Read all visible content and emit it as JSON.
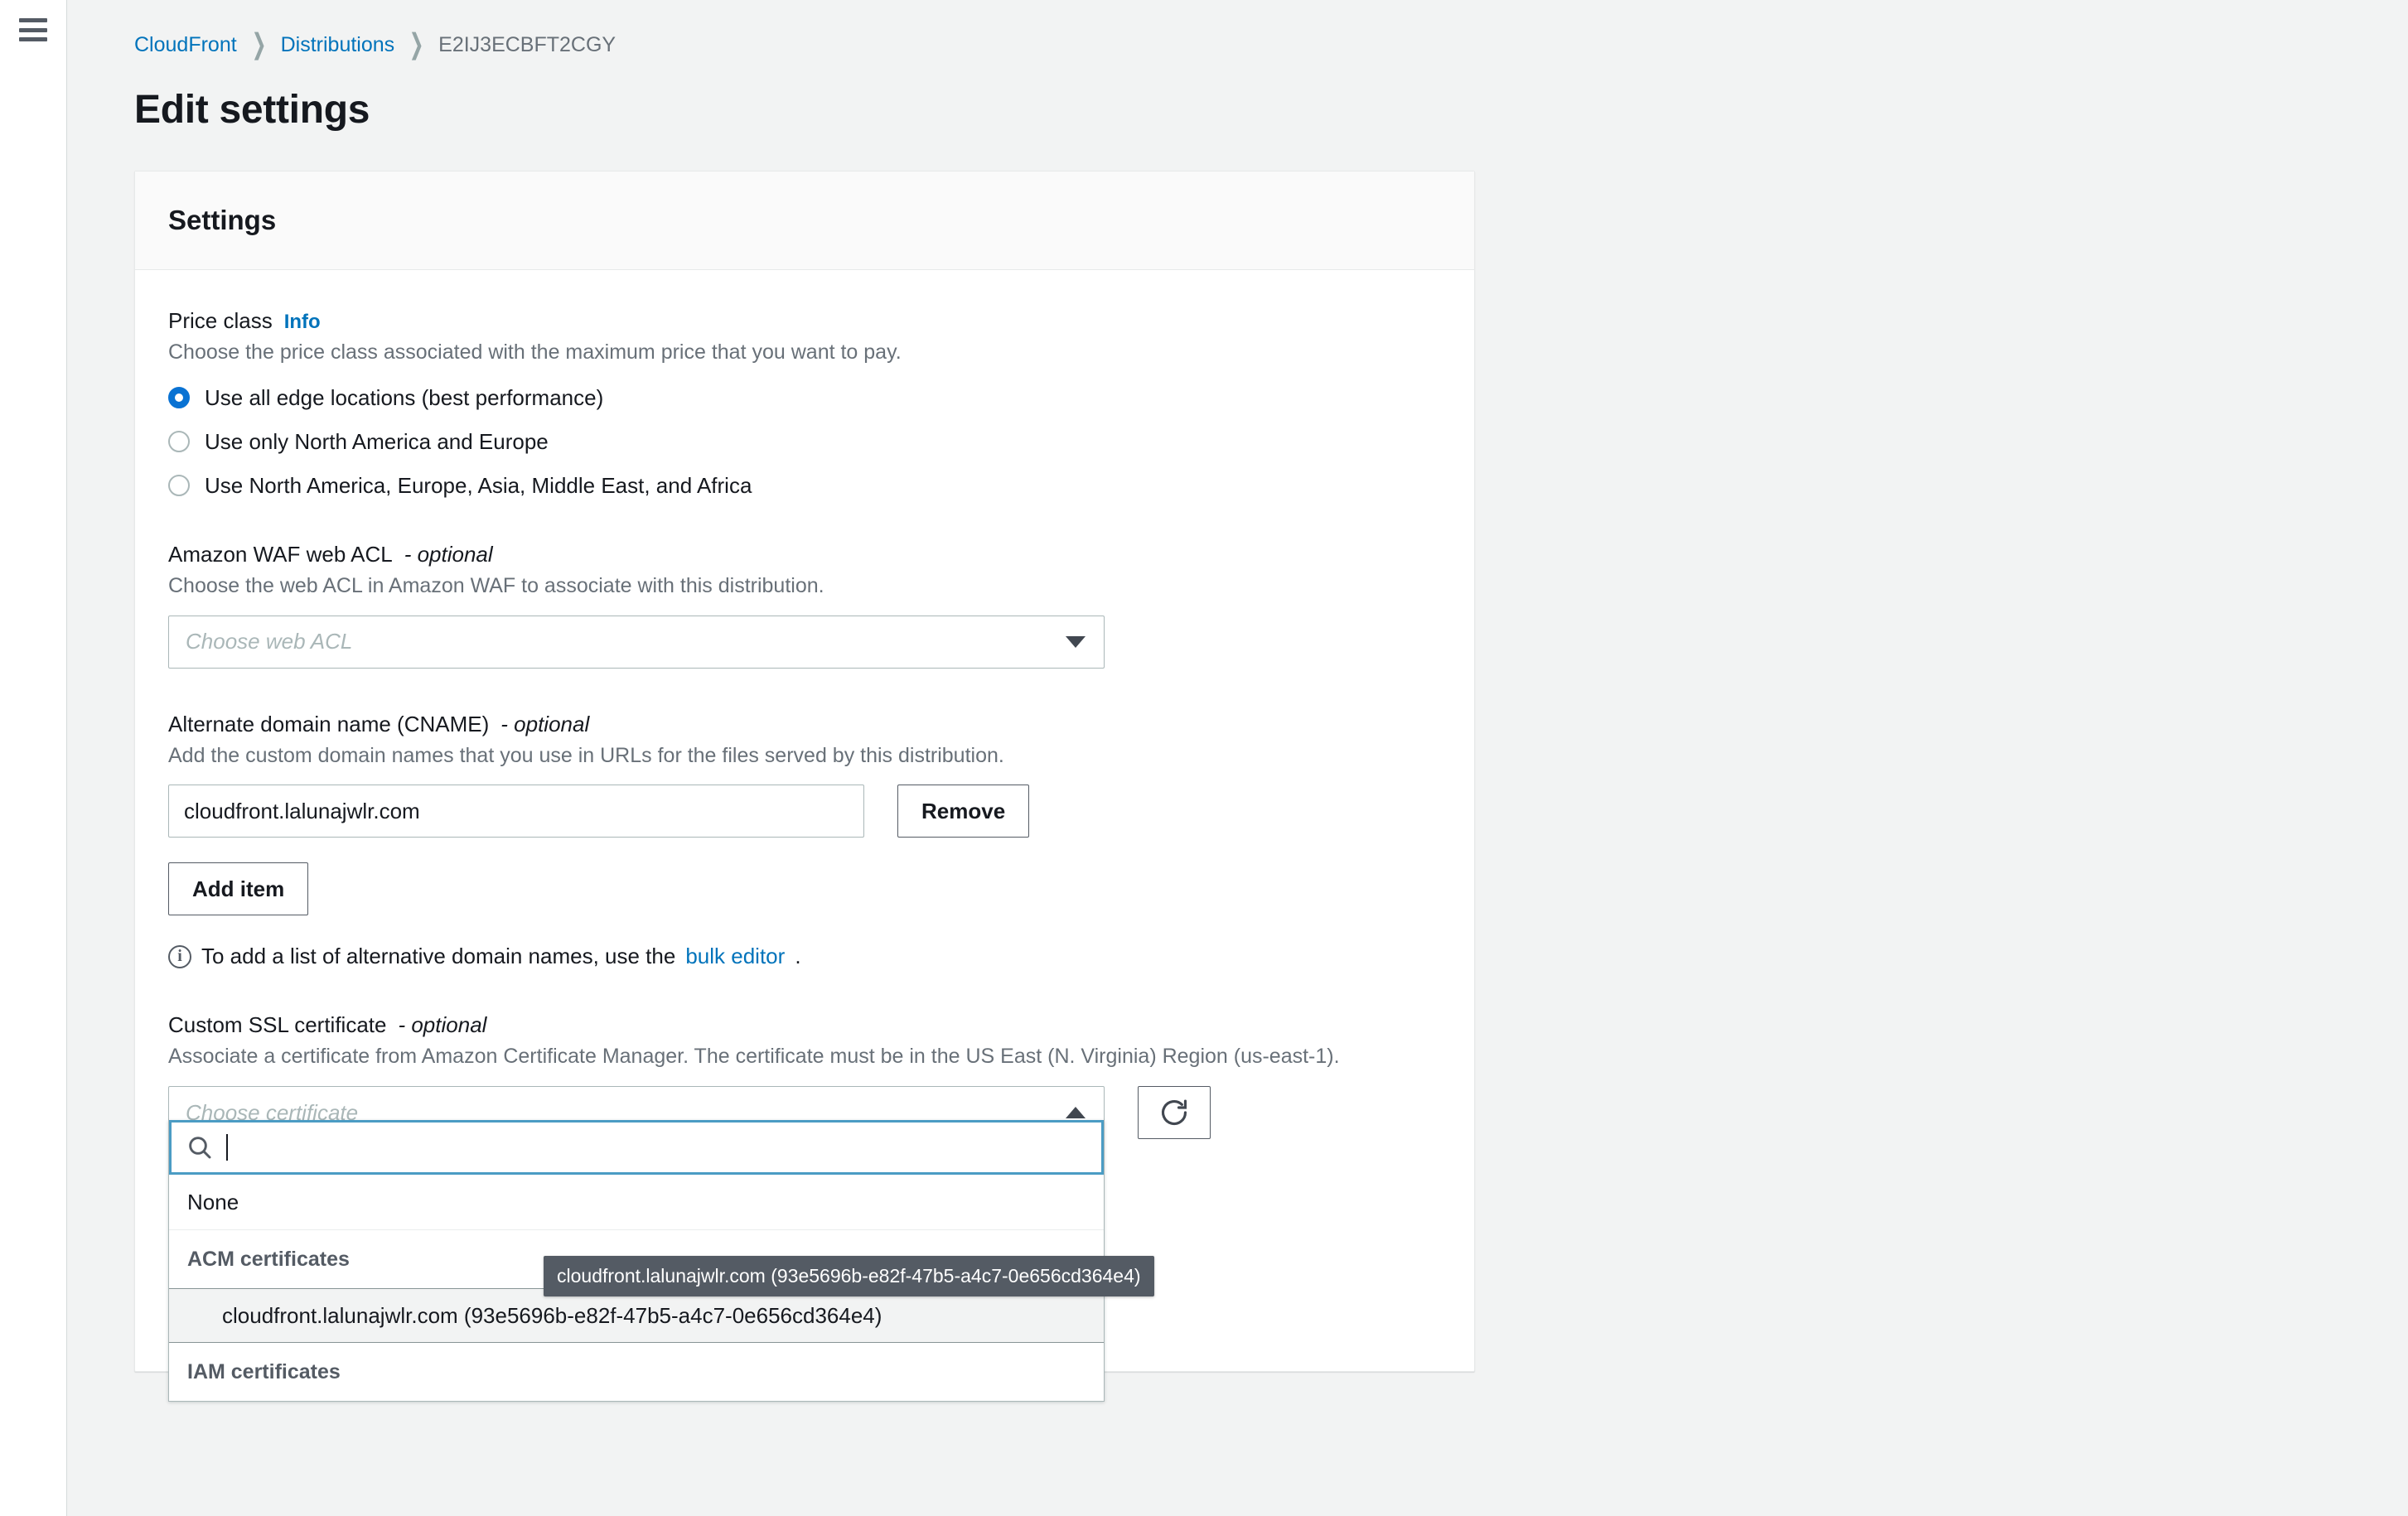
{
  "breadcrumb": {
    "items": [
      {
        "label": "CloudFront",
        "link": true
      },
      {
        "label": "Distributions",
        "link": true
      },
      {
        "label": "E2IJ3ECBFT2CGY",
        "link": false
      }
    ],
    "separator": "❯"
  },
  "page": {
    "title": "Edit settings"
  },
  "panel": {
    "header": "Settings"
  },
  "price_class": {
    "label": "Price class",
    "info_label": "Info",
    "description": "Choose the price class associated with the maximum price that you want to pay.",
    "options": [
      {
        "label": "Use all edge locations (best performance)",
        "selected": true
      },
      {
        "label": "Use only North America and Europe",
        "selected": false
      },
      {
        "label": "Use North America, Europe, Asia, Middle East, and Africa",
        "selected": false
      }
    ]
  },
  "waf": {
    "label": "Amazon WAF web ACL",
    "optional_suffix": "- optional",
    "description": "Choose the web ACL in Amazon WAF to associate with this distribution.",
    "select_placeholder": "Choose web ACL"
  },
  "cname": {
    "label": "Alternate domain name (CNAME)",
    "optional_suffix": "- optional",
    "description": "Add the custom domain names that you use in URLs for the files served by this distribution.",
    "value": "cloudfront.lalunajwlr.com",
    "remove_label": "Remove",
    "add_item_label": "Add item",
    "hint_prefix": "To add a list of alternative domain names, use the ",
    "hint_link": "bulk editor",
    "hint_suffix": "."
  },
  "ssl": {
    "label": "Custom SSL certificate",
    "optional_suffix": "- optional",
    "description": "Associate a certificate from Amazon Certificate Manager. The certificate must be in the US East (N. Virginia) Region (us-east-1).",
    "select_placeholder": "Choose certificate",
    "refresh_icon": "refresh-icon",
    "search_value": "",
    "dropdown": {
      "none_label": "None",
      "acm_group_label": "ACM certificates",
      "acm_items": [
        "cloudfront.lalunajwlr.com (93e5696b-e82f-47b5-a4c7-0e656cd364e4)"
      ],
      "iam_group_label": "IAM certificates"
    },
    "tooltip": "cloudfront.lalunajwlr.com (93e5696b-e82f-47b5-a4c7-0e656cd364e4)"
  },
  "colors": {
    "link": "#0073bb",
    "radio_accent": "#0972d3",
    "focus_border": "#4b9cc4",
    "tooltip_bg": "#545b64",
    "page_bg": "#f2f3f3",
    "panel_header_bg": "#fafafa",
    "border": "#aab7b8"
  }
}
